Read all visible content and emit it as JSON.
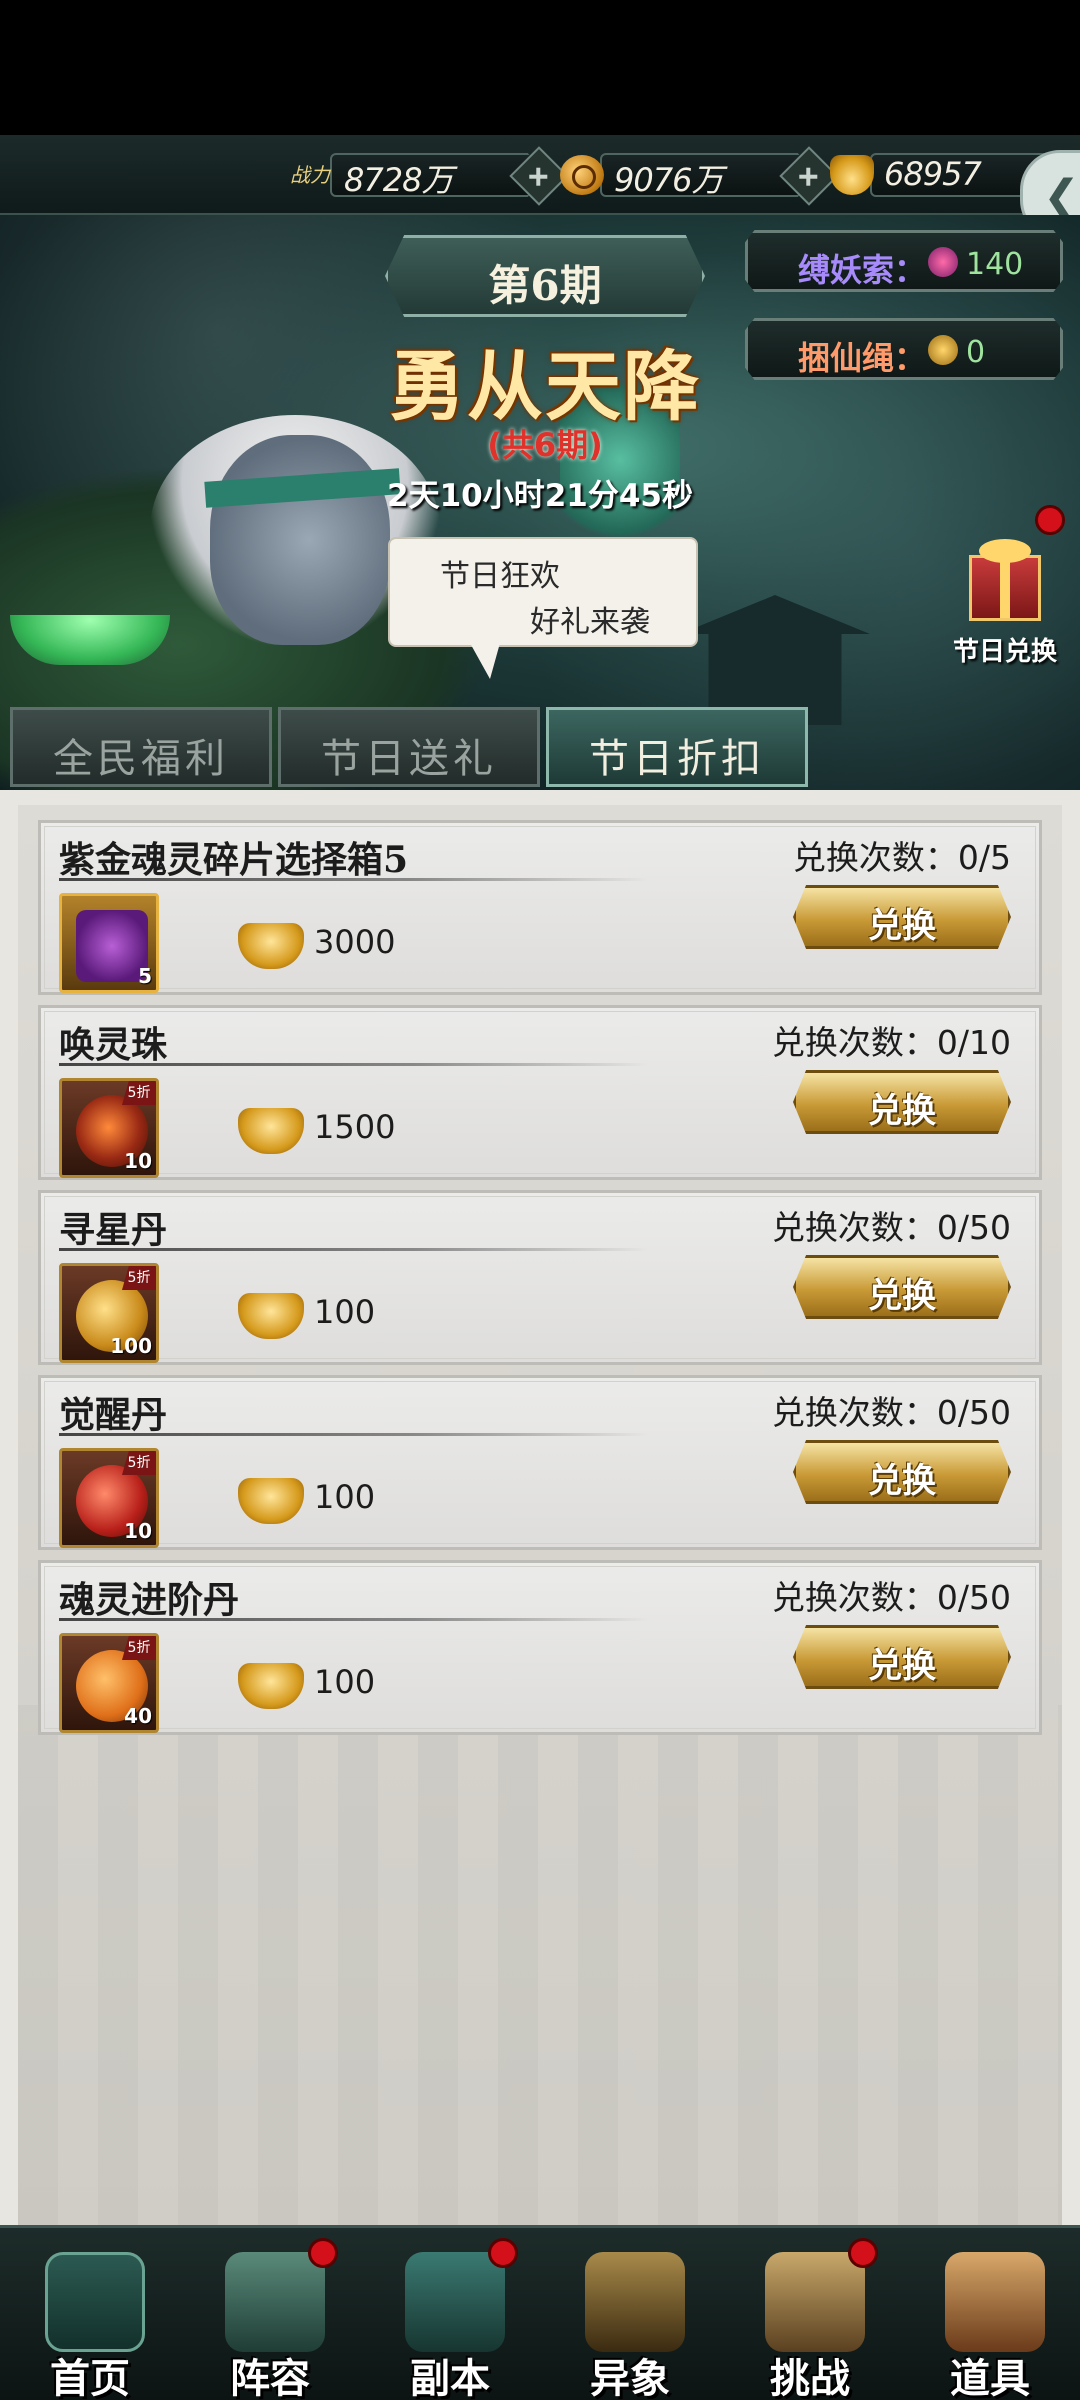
{
  "resources": {
    "power_label": "战力",
    "power_value": "8728万",
    "coin_value": "9076万",
    "ingot_value": "68957"
  },
  "banner": {
    "issue_label": "第6期",
    "title": "勇从天降",
    "sub_issue": "(共6期)",
    "timer": "2天10小时21分45秒",
    "bubble_line1": "节日狂欢",
    "bubble_line2": "好礼来袭",
    "stat1_label": "缚妖索：",
    "stat1_value": "140",
    "stat2_label": "捆仙绳：",
    "stat2_value": "0",
    "gift_label": "节日兑换"
  },
  "tabs": [
    {
      "label": "全民福利"
    },
    {
      "label": "节日送礼"
    },
    {
      "label": "节日折扣"
    }
  ],
  "items": [
    {
      "name": "紫金魂灵碎片选择箱5",
      "count": "兑换次数：0/5",
      "price": "3000",
      "qty": "5",
      "button": "兑换"
    },
    {
      "name": "唤灵珠",
      "count": "兑换次数：0/10",
      "price": "1500",
      "qty": "10",
      "tag": "5折",
      "button": "兑换"
    },
    {
      "name": "寻星丹",
      "count": "兑换次数：0/50",
      "price": "100",
      "qty": "100",
      "tag": "5折",
      "button": "兑换"
    },
    {
      "name": "觉醒丹",
      "count": "兑换次数：0/50",
      "price": "100",
      "qty": "10",
      "tag": "5折",
      "button": "兑换"
    },
    {
      "name": "魂灵进阶丹",
      "count": "兑换次数：0/50",
      "price": "100",
      "qty": "40",
      "tag": "5折",
      "button": "兑换"
    }
  ],
  "nav": [
    {
      "label": "首页"
    },
    {
      "label": "阵容"
    },
    {
      "label": "副本"
    },
    {
      "label": "异象"
    },
    {
      "label": "挑战"
    },
    {
      "label": "道具"
    }
  ],
  "colors": {
    "accent_gold": "#c99a36",
    "panel_bg": "#dddbd5",
    "nav_bg": "#1d2c2a",
    "badge_red": "#d4101a"
  }
}
